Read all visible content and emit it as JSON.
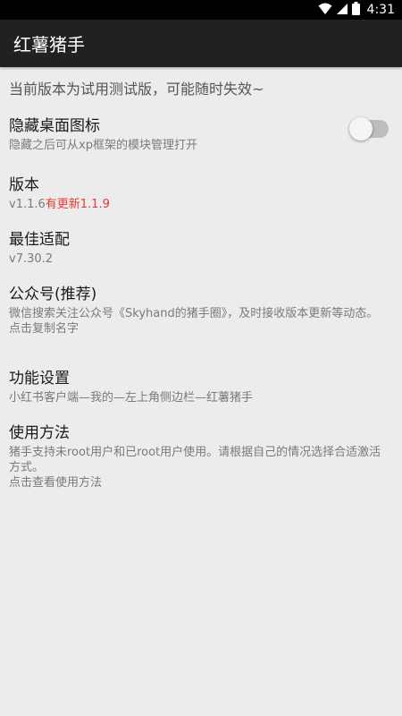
{
  "status_bar": {
    "time": "4:31",
    "icons": [
      "wifi-icon",
      "signal-icon",
      "battery-icon"
    ]
  },
  "toolbar": {
    "title": "红薯猪手"
  },
  "notice": "当前版本为试用测试版，可能随时失效~",
  "settings": {
    "hide_icon": {
      "title": "隐藏桌面图标",
      "summary": "隐藏之后可从xp框架的模块管理打开",
      "toggle_on": false
    },
    "version": {
      "title": "版本",
      "current": "v1.1.6",
      "update_text": "有更新1.1.9"
    },
    "best_fit": {
      "title": "最佳适配",
      "summary": "v7.30.2"
    },
    "wechat": {
      "title": "公众号(推荐)",
      "summary": "微信搜索关注公众号《Skyhand的猪手圈》，及时接收版本更新等动态。",
      "summary_action": "点击复制名字"
    },
    "feature": {
      "title": "功能设置",
      "summary": "小红书客户端—我的—左上角侧边栏—红薯猪手"
    },
    "usage": {
      "title": "使用方法",
      "summary": "猪手支持未root用户和已root用户使用。请根据自己的情况选择合适激活方式。",
      "summary_action": "点击查看使用方法"
    }
  },
  "colors": {
    "toolbar_bg": "#212121",
    "page_bg": "#ececec",
    "update_red": "#e53935"
  }
}
